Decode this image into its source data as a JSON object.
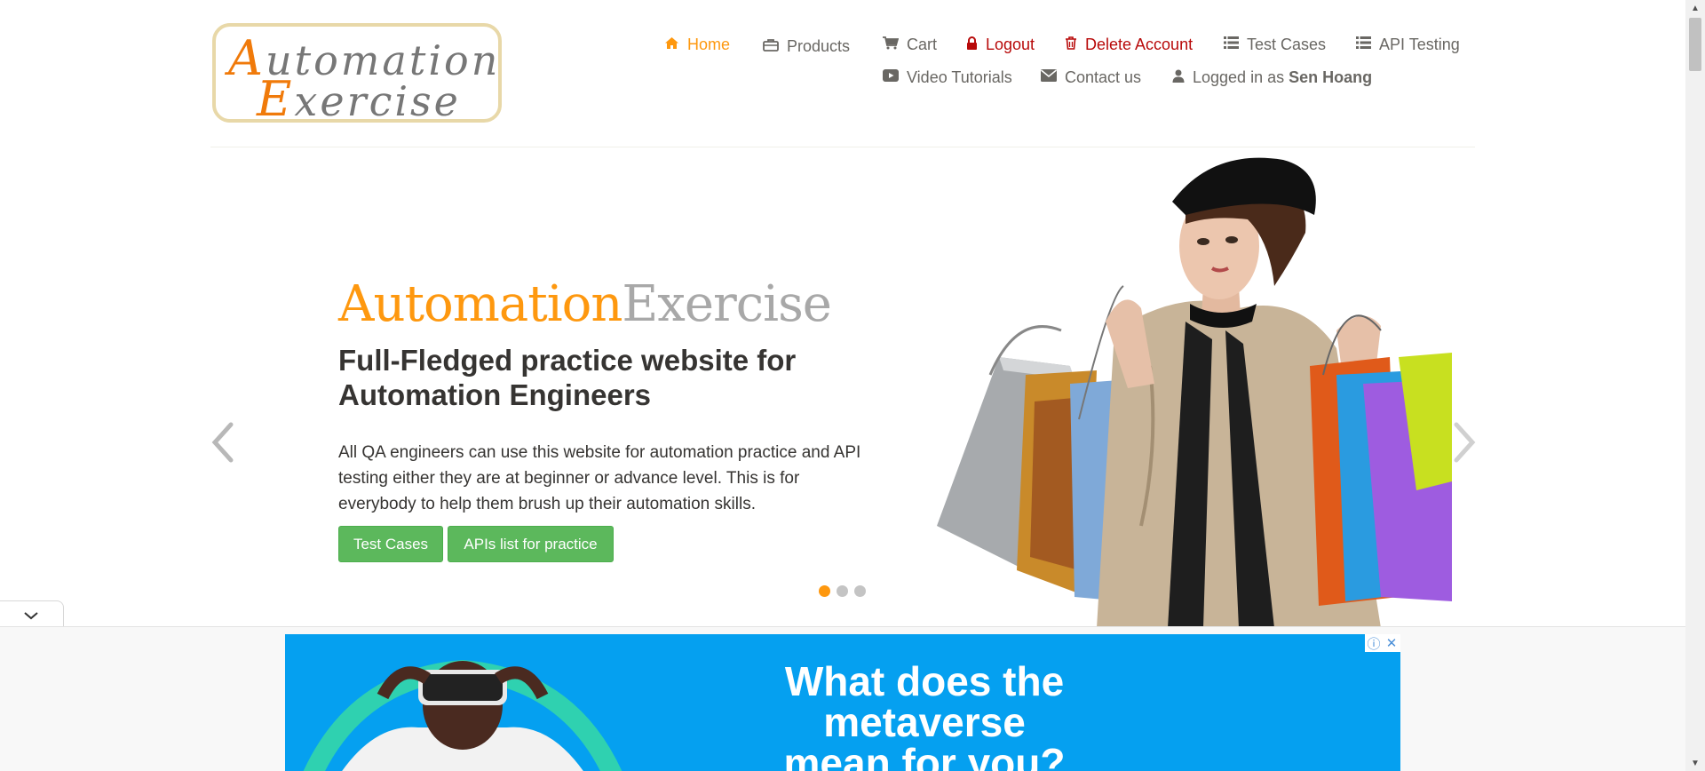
{
  "logo": {
    "line1_first": "A",
    "line1_rest": "utomation",
    "line2_first": "E",
    "line2_rest": "xercise"
  },
  "nav": {
    "home": {
      "label": "Home",
      "icon": "home-icon",
      "color": "#fe980f"
    },
    "products": {
      "label": "Products",
      "icon": "briefcase-icon"
    },
    "cart": {
      "label": "Cart",
      "icon": "cart-icon"
    },
    "logout": {
      "label": "Logout",
      "icon": "lock-icon",
      "color": "#b80a0a"
    },
    "delete_account": {
      "label": "Delete Account",
      "icon": "trash-icon",
      "color": "#b80a0a"
    },
    "test_cases": {
      "label": "Test Cases",
      "icon": "list-icon"
    },
    "api_testing": {
      "label": "API Testing",
      "icon": "list-icon"
    },
    "video_tutorials": {
      "label": "Video Tutorials",
      "icon": "youtube-icon"
    },
    "contact_us": {
      "label": "Contact us",
      "icon": "envelope-icon"
    },
    "logged_in": {
      "prefix": "Logged in as",
      "username": "Sen Hoang",
      "icon": "user-icon"
    }
  },
  "hero": {
    "brand_part1": "Automation",
    "brand_part2": "Exercise",
    "headline": "Full-Fledged practice website for Automation Engineers",
    "description": "All QA engineers can use this website for automation practice and API testing either they are at beginner or advance level. This is for everybody to help them brush up their automation skills.",
    "button_test_cases": "Test Cases",
    "button_apis": "APIs list for practice",
    "active_slide": 1,
    "slide_count": 3
  },
  "ad": {
    "headline_line1": "What does the metaverse",
    "headline_line2": "mean for you?"
  },
  "colors": {
    "accent": "#fe980f",
    "danger": "#b80a0a",
    "button_green": "#5cb85c",
    "ad_blue": "#05a0f0"
  }
}
